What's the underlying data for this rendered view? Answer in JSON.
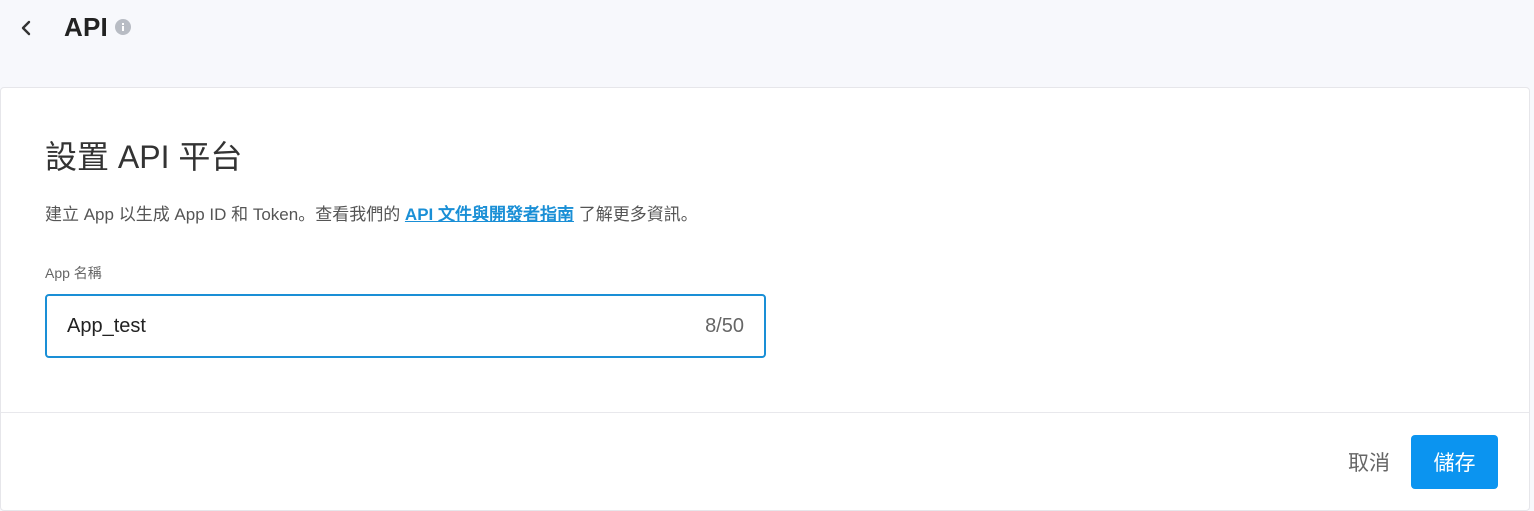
{
  "header": {
    "title": "API",
    "back_icon": "chevron-left-icon",
    "info_icon": "info-icon"
  },
  "card": {
    "title": "設置 API 平台",
    "description_prefix": "建立 App 以生成 App ID 和 Token。查看我們的 ",
    "description_link": "API 文件與開發者指南",
    "description_suffix": " 了解更多資訊。",
    "field_label": "App 名稱",
    "app_name_value": "App_test",
    "char_count": "8/50"
  },
  "footer": {
    "cancel_label": "取消",
    "save_label": "儲存"
  },
  "colors": {
    "accent": "#0b94f0",
    "link": "#1a8fd6",
    "page_bg": "#f7f8fc"
  }
}
